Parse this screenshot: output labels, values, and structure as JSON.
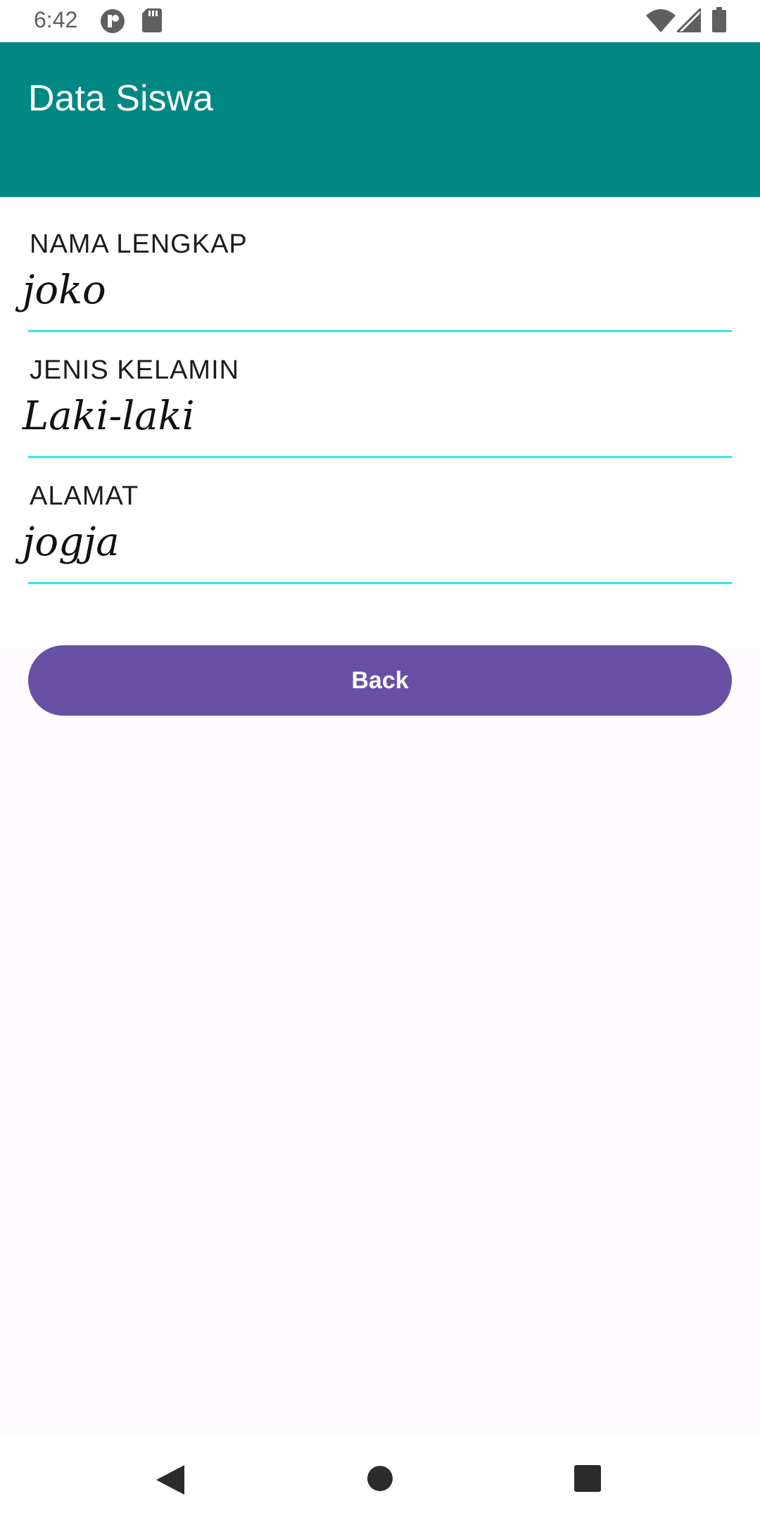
{
  "status_bar": {
    "time": "6:42",
    "icons": [
      "notification-app-icon",
      "sd-card-icon",
      "wifi-icon",
      "signal-icon",
      "battery-icon"
    ]
  },
  "app_bar": {
    "title": "Data Siswa",
    "color": "#008784"
  },
  "fields": [
    {
      "label": "NAMA LENGKAP",
      "value": "joko"
    },
    {
      "label": "JENIS KELAMIN",
      "value": "Laki-laki"
    },
    {
      "label": "ALAMAT",
      "value": "jogja"
    }
  ],
  "underline_color": "#2ee8ee",
  "back_button": {
    "label": "Back",
    "color": "#6750a4"
  },
  "nav_bar": {
    "icons": [
      "back-triangle-icon",
      "home-circle-icon",
      "recents-square-icon"
    ]
  }
}
